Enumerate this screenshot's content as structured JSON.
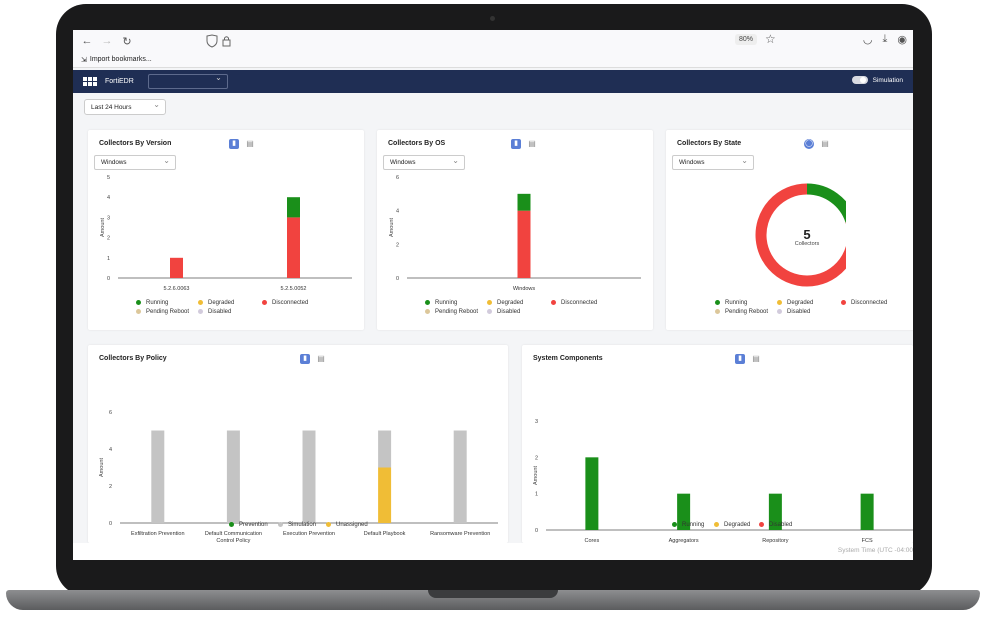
{
  "browser": {
    "zoom": "80%",
    "bookmark_label": "Import bookmarks..."
  },
  "app": {
    "name": "FortiEDR",
    "select_value": "",
    "simulation_label": "Simulation",
    "time_range": "Last 24 Hours"
  },
  "colors": {
    "running": "#1a8f1a",
    "degraded": "#f0bd36",
    "disconnected": "#f1433f",
    "pending": "#dcc79a",
    "disabled": "#d2cbdc",
    "simulation": "#c4c4c4",
    "header": "#1f2e54"
  },
  "cards": {
    "version": {
      "title": "Collectors By Version",
      "filter": "Windows"
    },
    "os": {
      "title": "Collectors By OS",
      "filter": "Windows"
    },
    "state": {
      "title": "Collectors By State",
      "filter": "Windows",
      "center_value": "5",
      "center_label": "Collectors"
    },
    "policy": {
      "title": "Collectors By Policy"
    },
    "components": {
      "title": "System Components"
    }
  },
  "legends": {
    "state": [
      "Running",
      "Degraded",
      "Disconnected",
      "Pending Reboot",
      "Disabled"
    ],
    "policy": [
      "Prevention",
      "Simulation",
      "Unassigned"
    ],
    "components": [
      "Running",
      "Degraded",
      "Disabled"
    ]
  },
  "footer": {
    "system_time": "System Time (UTC -04:00"
  },
  "chart_data": [
    {
      "type": "bar",
      "title": "Collectors By Version",
      "ylabel": "Amount",
      "ylim": [
        0,
        5
      ],
      "yticks": [
        0,
        1,
        2,
        3,
        4,
        5
      ],
      "categories": [
        "5.2.6.0063",
        "5.2.5.0052"
      ],
      "series": [
        {
          "name": "Disconnected",
          "values": [
            1,
            3
          ]
        },
        {
          "name": "Running",
          "values": [
            0,
            1
          ]
        }
      ]
    },
    {
      "type": "bar",
      "title": "Collectors By OS",
      "ylabel": "Amount",
      "ylim": [
        0,
        6
      ],
      "yticks": [
        0,
        2,
        4,
        6
      ],
      "categories": [
        "Windows"
      ],
      "series": [
        {
          "name": "Disconnected",
          "values": [
            4
          ]
        },
        {
          "name": "Running",
          "values": [
            1
          ]
        }
      ]
    },
    {
      "type": "pie",
      "title": "Collectors By State",
      "categories": [
        "Running",
        "Disconnected"
      ],
      "values": [
        1,
        4
      ]
    },
    {
      "type": "bar",
      "title": "Collectors By Policy",
      "ylabel": "Amount",
      "ylim": [
        0,
        6
      ],
      "yticks": [
        0,
        2,
        4,
        6
      ],
      "categories": [
        "Exfiltration Prevention",
        "Default Communication Control Policy",
        "Execution Prevention",
        "Default Playbook",
        "Ransomware Prevention"
      ],
      "series": [
        {
          "name": "Unassigned",
          "values": [
            0,
            0,
            0,
            3,
            0
          ]
        },
        {
          "name": "Simulation",
          "values": [
            5,
            5,
            5,
            2,
            5
          ]
        }
      ]
    },
    {
      "type": "bar",
      "title": "System Components",
      "ylabel": "Amount",
      "ylim": [
        0,
        3
      ],
      "yticks": [
        0,
        1,
        2,
        3
      ],
      "categories": [
        "Cores",
        "Aggregators",
        "Repository",
        "FCS"
      ],
      "series": [
        {
          "name": "Running",
          "values": [
            2,
            1,
            1,
            1
          ]
        }
      ]
    }
  ]
}
